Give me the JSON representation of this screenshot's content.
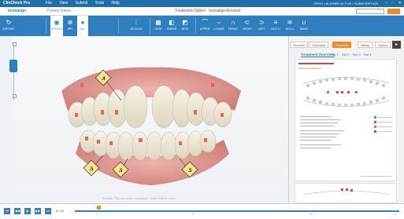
{
  "titlebar": {
    "app_name": "ClinCheck Pro",
    "menu": [
      "File",
      "View",
      "Submit",
      "Tools",
      "Help"
    ],
    "right_info": "ITERO • ALIGNER ACTIVE • SUBSCRIPTION",
    "win_controls": [
      "–",
      "□",
      "✕"
    ]
  },
  "header": {
    "logo": "invisalign",
    "patient_label": "Patient Name",
    "center_title": "Treatment Option · Invisalign Account"
  },
  "toolbar": {
    "items": [
      {
        "label": "EXPORT",
        "icon": "↻"
      },
      {
        "label": "ATTACH",
        "icon": "◉"
      },
      {
        "label": "IPR",
        "icon": "⊕"
      },
      {
        "label": "ALL",
        "icon": "●"
      },
      {
        "label": "OCCLUS",
        "icon": "⋮"
      },
      {
        "label": "GRID",
        "icon": "▦"
      },
      {
        "label": "SUPER",
        "icon": "◧"
      },
      {
        "label": "BITE",
        "icon": "◩"
      },
      {
        "label": "UPPER",
        "icon": "⌒"
      },
      {
        "label": "LOWER",
        "icon": "⌣"
      },
      {
        "label": "FRONT",
        "icon": "∩"
      },
      {
        "label": "RIGHT",
        "icon": "⊂"
      },
      {
        "label": "LEFT",
        "icon": "⊃"
      },
      {
        "label": "OCC U",
        "icon": "≡"
      },
      {
        "label": "OCC L",
        "icon": "≋"
      },
      {
        "label": "BACK",
        "icon": "∪"
      }
    ]
  },
  "ipr_labels": [
    ".4",
    ".5",
    ".5",
    ".5"
  ],
  "view_hint": "Rotation, Pan and Zoom commands · (Hold Shift for more)",
  "right_panel": {
    "tabs": [
      "Overview",
      "Comments",
      "Treatment",
      "History",
      "Options"
    ],
    "active_tab": "Treatment",
    "section_title": "Treatment Overview",
    "sub_links": [
      "Ref 1",
      "Ref 2",
      "Ref 3",
      "Ref 4"
    ],
    "doc_title": "Treatment Overview 1"
  },
  "bottom": {
    "play_buttons": [
      "⏮",
      "◀◀",
      "▶",
      "▶▶",
      "⏭"
    ],
    "stage_count": "0 / 14",
    "timeline_ticks": [
      "0",
      "5",
      "10",
      "14"
    ]
  },
  "colors": {
    "toolbar_blue": "#2f7fbf",
    "accent_orange": "#f08a24",
    "gum_pink": "#e49a96"
  }
}
